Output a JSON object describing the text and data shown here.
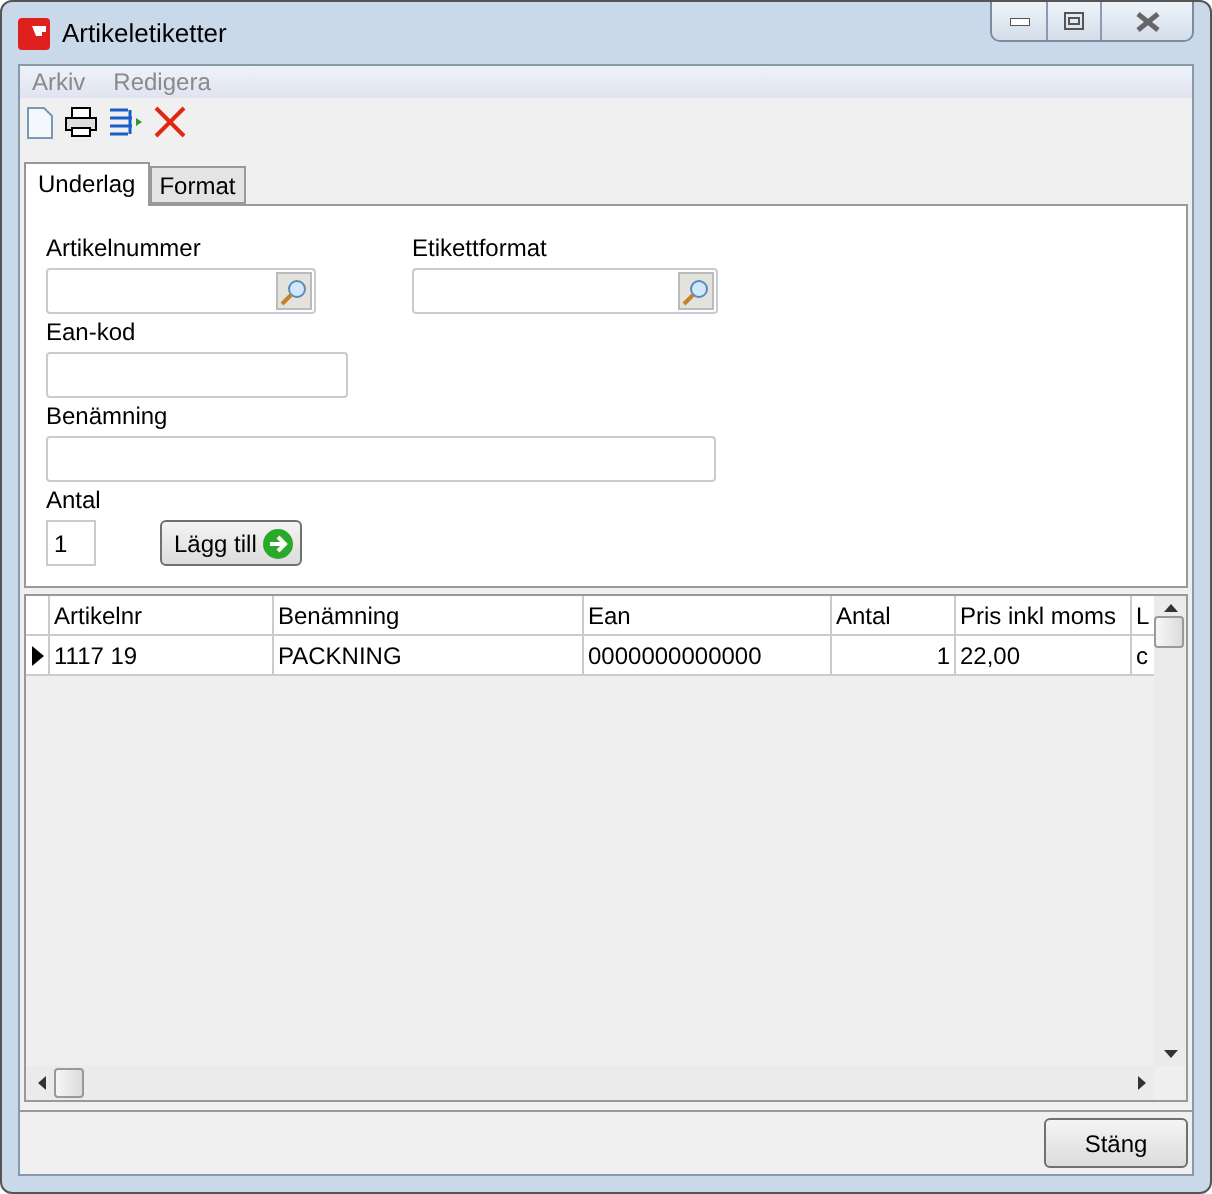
{
  "window": {
    "title": "Artikeletiketter"
  },
  "menu": [
    "Arkiv",
    "Redigera"
  ],
  "tabs": [
    {
      "label": "Underlag",
      "selected": true
    },
    {
      "label": "Format",
      "selected": false
    }
  ],
  "form": {
    "artikelnummer": {
      "label": "Artikelnummer"
    },
    "etikettformat": {
      "label": "Etikettformat"
    },
    "ean": {
      "label": "Ean-kod"
    },
    "benamning": {
      "label": "Benämning"
    },
    "antal": {
      "label": "Antal",
      "value": "1"
    },
    "add_button": "Lägg till"
  },
  "table": {
    "columns": [
      "Artikelnr",
      "Benämning",
      "Ean",
      "Antal",
      "Pris inkl moms",
      "L"
    ],
    "rows": [
      {
        "selected": true,
        "cells": [
          "1117 19",
          "PACKNING",
          "0000000000000",
          "1",
          "22,00",
          "c"
        ]
      }
    ]
  },
  "close_button": "Stäng"
}
